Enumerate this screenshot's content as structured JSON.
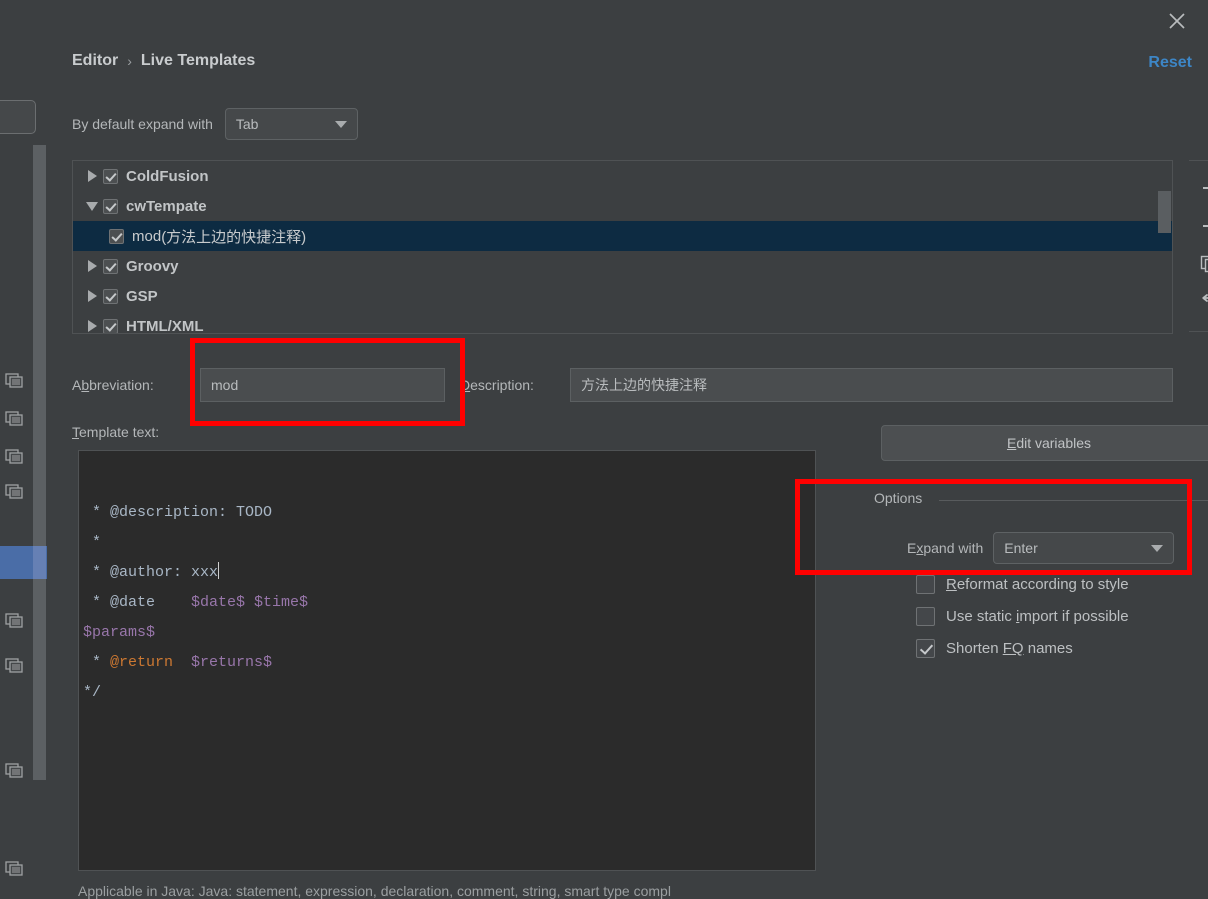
{
  "window": {
    "close_icon": "close-icon"
  },
  "header": {
    "breadcrumb_root": "Editor",
    "breadcrumb_sep": "›",
    "breadcrumb_current": "Live Templates",
    "reset_label": "Reset"
  },
  "default_expand": {
    "label": "By default expand with",
    "value": "Tab"
  },
  "tree": {
    "rows": [
      {
        "label": "ColdFusion",
        "checked": true,
        "expanded": false,
        "child": false,
        "selected": false,
        "desc": ""
      },
      {
        "label": "cwTempate",
        "checked": true,
        "expanded": true,
        "child": false,
        "selected": false,
        "desc": ""
      },
      {
        "label": "mod",
        "checked": true,
        "expanded": null,
        "child": true,
        "selected": true,
        "desc": "(方法上边的快捷注释)"
      },
      {
        "label": "Groovy",
        "checked": true,
        "expanded": false,
        "child": false,
        "selected": false,
        "desc": ""
      },
      {
        "label": "GSP",
        "checked": true,
        "expanded": false,
        "child": false,
        "selected": false,
        "desc": ""
      },
      {
        "label": "HTML/XML",
        "checked": true,
        "expanded": false,
        "child": false,
        "selected": false,
        "desc": ""
      }
    ],
    "tools": [
      {
        "name": "add-template-button",
        "icon": "plus-icon"
      },
      {
        "name": "remove-template-button",
        "icon": "minus-icon"
      },
      {
        "name": "duplicate-template-button",
        "icon": "copy-icon"
      },
      {
        "name": "restore-defaults-button",
        "icon": "undo-icon"
      }
    ]
  },
  "fields": {
    "abbreviation_label": "Abbreviation:",
    "abbreviation_mnemonic": "b",
    "abbreviation_value": "mod",
    "description_label": "Description:",
    "description_mnemonic": "D",
    "description_value": "方法上边的快捷注释"
  },
  "template_text": {
    "label": "Template text:",
    "label_mnemonic": "T",
    "lines": [
      {
        "segments": []
      },
      {
        "segments": [
          {
            "t": " * @description: TODO",
            "c": "plain"
          }
        ]
      },
      {
        "segments": [
          {
            "t": " *",
            "c": "plain"
          }
        ]
      },
      {
        "segments": [
          {
            "t": " * @author: xxx",
            "c": "plain"
          }
        ],
        "caret": true
      },
      {
        "segments": [
          {
            "t": " * @date    ",
            "c": "plain"
          },
          {
            "t": "$date$ $time$",
            "c": "var"
          }
        ]
      },
      {
        "segments": [
          {
            "t": "$params$",
            "c": "var"
          }
        ]
      },
      {
        "segments": [
          {
            "t": " * ",
            "c": "plain"
          },
          {
            "t": "@return",
            "c": "kw"
          },
          {
            "t": "  ",
            "c": "plain"
          },
          {
            "t": "$returns$",
            "c": "var"
          }
        ]
      },
      {
        "segments": [
          {
            "t": "*/",
            "c": "plain"
          }
        ]
      }
    ]
  },
  "right_panel": {
    "edit_variables_label": "Edit variables",
    "edit_variables_mnemonic": "E",
    "options_title": "Options",
    "expand_with_label": "Expand with",
    "expand_with_mnemonic": "x",
    "expand_with_value": "Enter",
    "checkboxes": [
      {
        "label": "Reformat according to style",
        "mnemonic": "R",
        "checked": false,
        "name": "reformat-according-to-style-checkbox"
      },
      {
        "label": "Use static import if possible",
        "mnemonic": "i",
        "checked": false,
        "name": "use-static-import-checkbox"
      },
      {
        "label": "Shorten FQ names",
        "mnemonic": "FQ",
        "checked": true,
        "name": "shorten-fq-names-checkbox"
      }
    ]
  },
  "footer": {
    "applicable_note": "Applicable in Java: Java: statement, expression, declaration, comment, string, smart type compl"
  },
  "colors": {
    "dialog_bg": "#3c3f41",
    "editor_bg": "#2b2b2b",
    "accent_link": "#3d86c6",
    "selection_row": "#0d2b42",
    "annotation_red": "#ff0000",
    "token_variable": "#9876aa",
    "token_keyword": "#cc7832",
    "token_plain": "#a9b7c6",
    "bg_panel_selection": "#4a6da7"
  }
}
